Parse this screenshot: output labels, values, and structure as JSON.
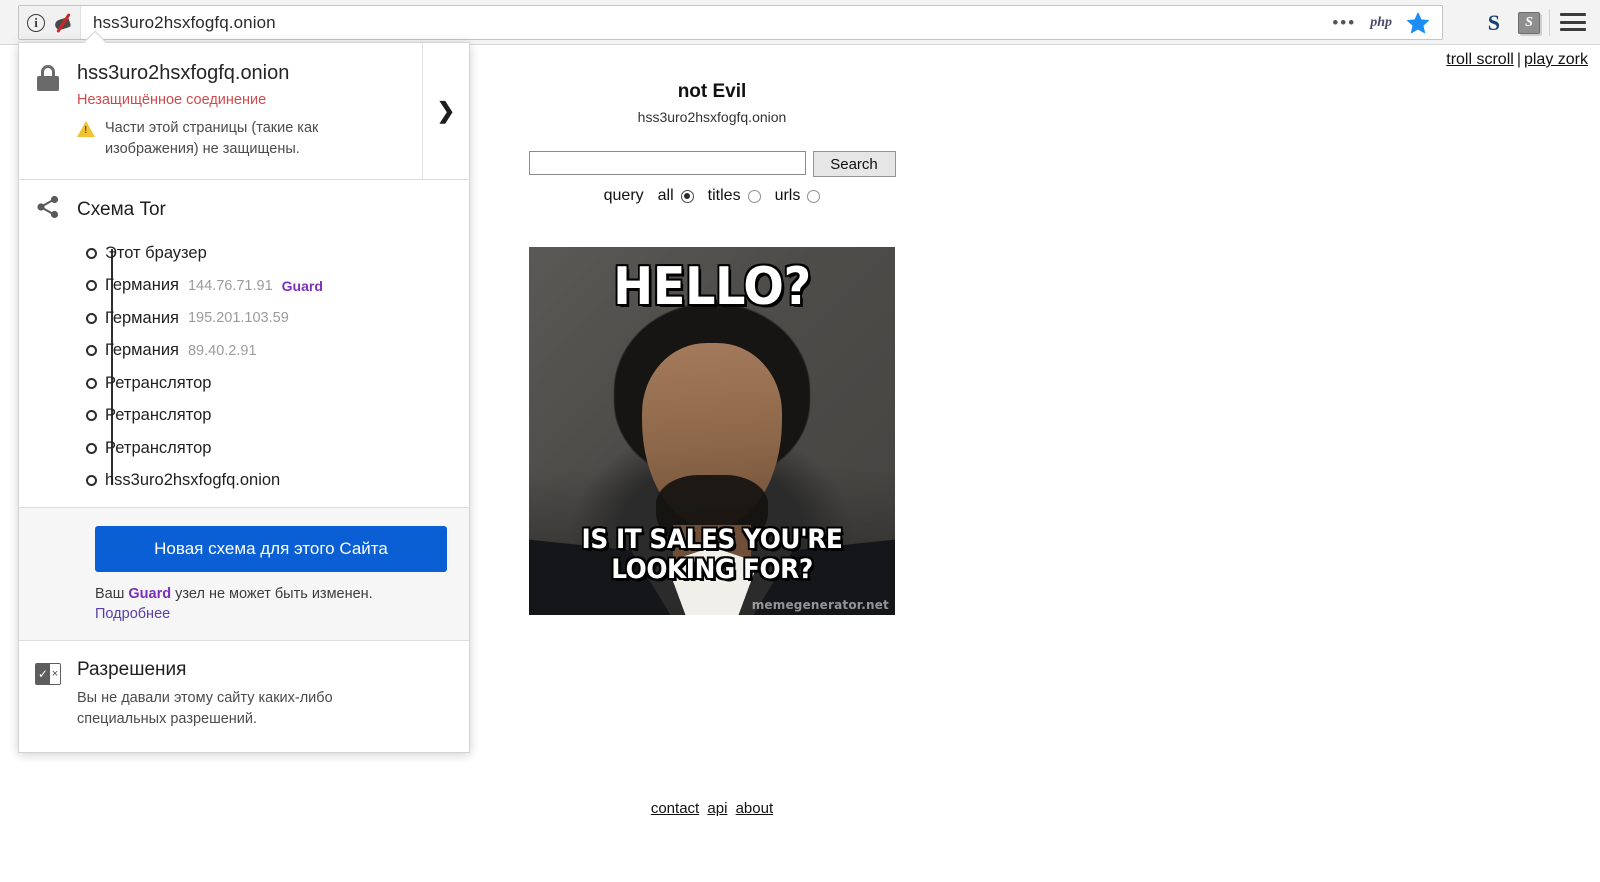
{
  "browser": {
    "url": "hss3uro2hsxfogfq.onion",
    "identity_icon": "info-circle-icon",
    "noscript_icon": "noscript-icon",
    "overflow_icon": "•••",
    "php_icon_label": "php",
    "bookmark_icon": "star-icon",
    "extension_1_label": "S",
    "extension_2_label": "S",
    "menu_icon": "hamburger-menu-icon"
  },
  "panel": {
    "security": {
      "host": "hss3uro2hsxfogfq.onion",
      "status": "Незащищённое соединение",
      "warning": "Части этой страницы (такие как изображения) не защищены.",
      "expand_chevron": "❯"
    },
    "tor": {
      "title": "Схема Tor",
      "nodes": [
        {
          "name": "Этот браузер",
          "ip": "",
          "tag": ""
        },
        {
          "name": "Германия",
          "ip": "144.76.71.91",
          "tag": "Guard"
        },
        {
          "name": "Германия",
          "ip": "195.201.103.59",
          "tag": ""
        },
        {
          "name": "Германия",
          "ip": "89.40.2.91",
          "tag": ""
        },
        {
          "name": "Ретранслятор",
          "ip": "",
          "tag": ""
        },
        {
          "name": "Ретранслятор",
          "ip": "",
          "tag": ""
        },
        {
          "name": "Ретранслятор",
          "ip": "",
          "tag": ""
        },
        {
          "name": "hss3uro2hsxfogfq.onion",
          "ip": "",
          "tag": ""
        }
      ],
      "new_circuit_button": "Новая схема для этого Сайта",
      "note_before": "Ваш ",
      "note_bold": "Guard",
      "note_after": " узел не может быть изменен.",
      "more_link": "Подробнее"
    },
    "permissions": {
      "title": "Разрешения",
      "text": "Вы не давали этому сайту каких-либо специальных разрешений.",
      "icon_check": "✓",
      "icon_cross": "×"
    }
  },
  "page": {
    "top_links": {
      "left": "troll scroll",
      "separator": "|",
      "right": "play zork"
    },
    "site_title": "not Evil",
    "site_host": "hss3uro2hsxfogfq.onion",
    "search": {
      "value": "",
      "placeholder": "",
      "button_label": "Search",
      "query_label": "query",
      "options": [
        {
          "label": "all",
          "checked": true
        },
        {
          "label": "titles",
          "checked": false
        },
        {
          "label": "urls",
          "checked": false
        }
      ]
    },
    "meme": {
      "top_text": "HELLO?",
      "bottom_text": "IS IT SALES YOU'RE LOOKING FOR?",
      "watermark": "memegenerator.net"
    },
    "footer_links": [
      "contact",
      "api",
      "about"
    ]
  },
  "colors": {
    "accent_blue": "#0a5fd4",
    "guard_purple": "#7b2fbe",
    "insecure_red": "#d14a4a",
    "warning_yellow": "#f2c231",
    "link_purple": "#5a3fa8"
  }
}
